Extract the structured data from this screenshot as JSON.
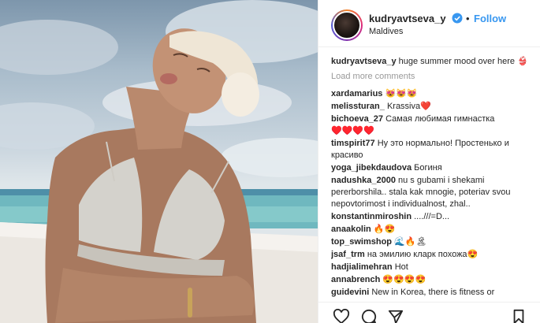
{
  "post": {
    "username": "kudryavtseva_y",
    "follow_label": "Follow",
    "separator": "•",
    "location": "Maldives",
    "caption_user": "kudryavtseva_y",
    "caption_text": "huge summer mood over here 👙",
    "load_more": "Load more comments",
    "comments": [
      {
        "user": "xardamarius",
        "text": "😻😻😻"
      },
      {
        "user": "melissturan_",
        "text": "Krassiva❤️"
      },
      {
        "user": "bichoeva_27",
        "text": "Самая любимая гимнастка ♥️♥️♥️♥️"
      },
      {
        "user": "timspirit77",
        "text": "Ну это нормально! Простенько и красиво"
      },
      {
        "user": "yoga_jibekdaudova",
        "text": "Богиня"
      },
      {
        "user": "nadushka_2000",
        "text": "nu s gubami i shekami pererborshila.. stala kak mnogie, poteriav svou nepovtorimost i individualnost, zhal.."
      },
      {
        "user": "konstantinmiroshin",
        "text": "....///=D..."
      },
      {
        "user": "anaakolin",
        "text": "🔥😍"
      },
      {
        "user": "top_swimshop",
        "text": "🌊🔥🏝"
      },
      {
        "user": "jsaf_trm",
        "text": "на эмилию кларк похожа😍"
      },
      {
        "user": "hadjialimehran",
        "text": "Hot"
      },
      {
        "user": "annabrench",
        "text": "😍😍😍😍"
      },
      {
        "user": "guidevini",
        "text": "New in Korea, there is fitness or"
      }
    ]
  },
  "colors": {
    "link": "#3897f0",
    "muted": "#999999",
    "text": "#262626",
    "verified": "#3897f0"
  },
  "icons": [
    "verified-badge-icon",
    "heart-icon",
    "comment-icon",
    "share-icon",
    "bookmark-icon"
  ]
}
